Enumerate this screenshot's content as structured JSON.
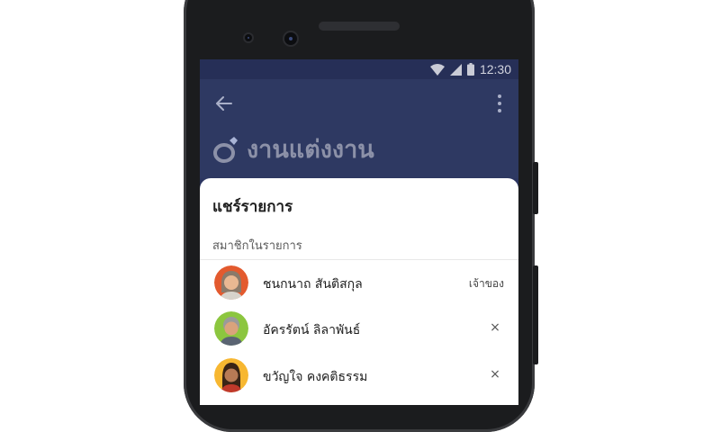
{
  "status_bar": {
    "time": "12:30",
    "icons": [
      "wifi-icon",
      "signal-icon",
      "battery-icon"
    ]
  },
  "app_bar": {
    "back_icon": "arrow-left-icon",
    "more_icon": "more-vertical-icon",
    "list_icon": "ring-icon",
    "list_title": "งานแต่งงาน"
  },
  "share_sheet": {
    "title": "แชร์รายการ",
    "section_label": "สมาชิกในรายการ",
    "members": [
      {
        "name": "ชนกนาถ สันติสกุล",
        "role_label": "เจ้าของ",
        "removable": false
      },
      {
        "name": "อัครรัตน์ ลิลาพันธ์",
        "role_label": "",
        "removable": true,
        "remove_symbol": "×"
      },
      {
        "name": "ขวัญใจ คงคติธรรม",
        "role_label": "",
        "removable": true,
        "remove_symbol": "×"
      }
    ]
  },
  "colors": {
    "app_bar_bg": "#2e3962",
    "status_bar_bg": "#262f57",
    "title_text": "#8c91a8",
    "avatar_1_bg": "#e35a2e",
    "avatar_2_bg": "#8cc63f",
    "avatar_3_bg": "#f7b731"
  }
}
